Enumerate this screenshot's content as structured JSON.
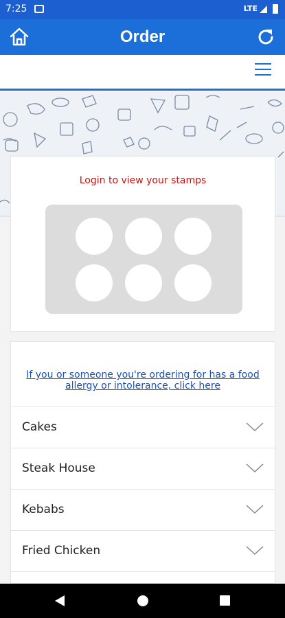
{
  "status_bar": {
    "time": "7:25",
    "network": "LTE"
  },
  "app_bar": {
    "title": "Order"
  },
  "stamps": {
    "login_prompt": "Login to view your stamps",
    "count": 6
  },
  "allergy": {
    "link_text": "If you or someone you're ordering for has a food allergy or intolerance, click here"
  },
  "categories": [
    {
      "label": "Cakes"
    },
    {
      "label": "Steak House"
    },
    {
      "label": "Kebabs"
    },
    {
      "label": "Fried Chicken"
    }
  ],
  "colors": {
    "primary": "#1c6fd8",
    "status_bar": "#1c5fd0",
    "login_text": "#cc1111",
    "link": "#1a53b5"
  }
}
